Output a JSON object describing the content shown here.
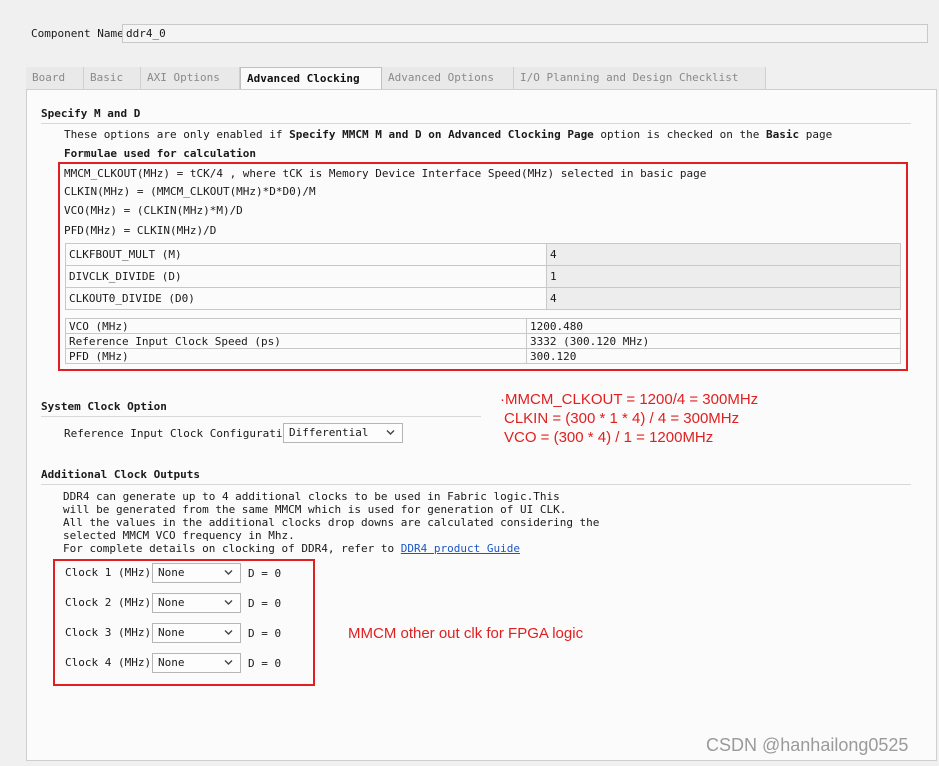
{
  "component": {
    "label": "Component Name",
    "value": "ddr4_0"
  },
  "tabs": [
    {
      "label": "Board"
    },
    {
      "label": "Basic"
    },
    {
      "label": "AXI Options"
    },
    {
      "label": "Advanced Clocking",
      "active": true
    },
    {
      "label": "Advanced Options"
    },
    {
      "label": "I/O Planning and Design Checklist"
    }
  ],
  "specify": {
    "title": "Specify M and D",
    "note_parts": [
      "These options are only enabled if ",
      "Specify MMCM M and D on Advanced Clocking Page",
      " option is checked on the ",
      "Basic",
      " page"
    ],
    "formulae_title": "Formulae used for calculation",
    "formulas": [
      "MMCM_CLKOUT(MHz) = tCK/4 , where tCK is Memory Device Interface Speed(MHz) selected in basic page",
      "CLKIN(MHz) = (MMCM_CLKOUT(MHz)*D*D0)/M",
      "VCO(MHz) = (CLKIN(MHz)*M)/D",
      "PFD(MHz) = CLKIN(MHz)/D"
    ],
    "params": [
      {
        "label": "CLKFBOUT_MULT (M)",
        "value": "4"
      },
      {
        "label": "DIVCLK_DIVIDE (D)",
        "value": "1"
      },
      {
        "label": "CLKOUT0_DIVIDE (D0)",
        "value": "4"
      }
    ],
    "results": [
      {
        "label": "VCO (MHz)",
        "value": "1200.480"
      },
      {
        "label": "Reference Input Clock Speed (ps)",
        "value": "3332 (300.120 MHz)"
      },
      {
        "label": "PFD (MHz)",
        "value": "300.120"
      }
    ]
  },
  "annotation_calc": [
    "·MMCM_CLKOUT = 1200/4 = 300MHz",
    "CLKIN = (300 * 1 * 4) / 4 = 300MHz",
    "VCO = (300 * 4) / 1 = 1200MHz"
  ],
  "system_clock": {
    "title": "System Clock Option",
    "ref_label": "Reference Input Clock Configuration",
    "ref_value": "Differential"
  },
  "additional": {
    "title": "Additional Clock Outputs",
    "desc": [
      "DDR4 can generate up to 4 additional clocks to be used in Fabric logic.This",
      "will be generated from the same MMCM which is used for generation of UI CLK.",
      "All the values in the additional clocks drop downs are calculated considering the",
      "selected MMCM VCO frequency in Mhz."
    ],
    "link_prefix": "For complete details on clocking of DDR4, refer to ",
    "link_text": "DDR4 product Guide",
    "clocks": [
      {
        "label": "Clock 1 (MHz)",
        "value": "None",
        "d": "D = 0"
      },
      {
        "label": "Clock 2 (MHz)",
        "value": "None",
        "d": "D = 0"
      },
      {
        "label": "Clock 3 (MHz)",
        "value": "None",
        "d": "D = 0"
      },
      {
        "label": "Clock 4 (MHz)",
        "value": "None",
        "d": "D = 0"
      }
    ]
  },
  "annotation_clk": "MMCM other out clk for FPGA logic",
  "watermark": "CSDN @hanhailong0525",
  "icons": {
    "dropdown": "chevron-down-icon"
  }
}
